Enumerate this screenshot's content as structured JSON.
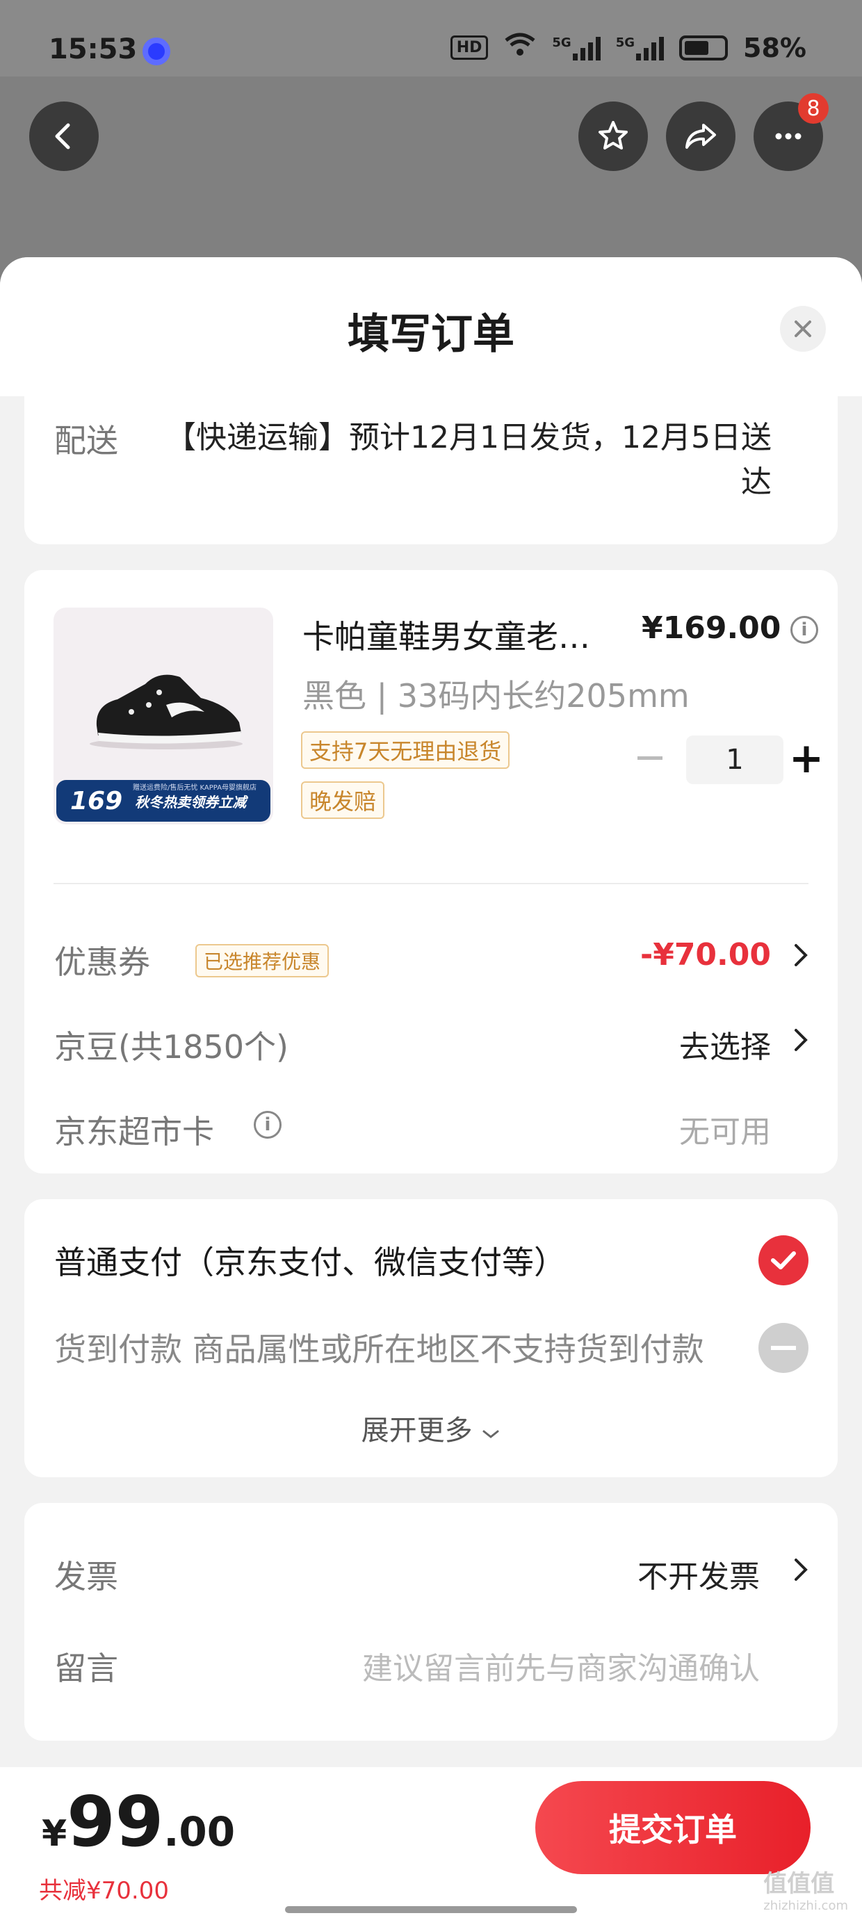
{
  "status": {
    "time": "15:53",
    "hd": "HD",
    "net1": "5G",
    "net2": "5G",
    "battery": "58%"
  },
  "nav": {
    "more_badge": "8"
  },
  "sheet": {
    "title": "填写订单"
  },
  "delivery": {
    "label": "配送",
    "text": "【快递运输】预计12月1日发货，12月5日送达"
  },
  "product": {
    "name": "卡帕童鞋男女童老…",
    "price": "¥169.00",
    "spec": "黑色 | 33码内长约205mm",
    "tags": [
      "支持7天无理由退货",
      "晚发赔"
    ],
    "quantity": "1",
    "banner_price": "169",
    "banner_text": "秋冬热卖领券立减",
    "banner_top": "赠送运费险/售后无忧  KAPPA母婴旗舰店"
  },
  "coupon": {
    "label": "优惠券",
    "tag": "已选推荐优惠",
    "value": "-¥70.00"
  },
  "jingdou": {
    "label": "京豆(共1850个)",
    "value": "去选择"
  },
  "market_card": {
    "label": "京东超市卡",
    "value": "无可用"
  },
  "payment": {
    "main": "普通支付（京东支付、微信支付等）",
    "cod": "货到付款  商品属性或所在地区不支持货到付款",
    "expand": "展开更多"
  },
  "invoice": {
    "label": "发票",
    "value": "不开发票"
  },
  "message": {
    "label": "留言",
    "placeholder": "建议留言前先与商家沟通确认"
  },
  "footer": {
    "yen": "¥",
    "total_int": "99",
    "total_dec": ".00",
    "saved": "共减¥70.00",
    "submit": "提交订单"
  },
  "watermark": {
    "text": "值值值",
    "sub": "zhizhizhi.com"
  },
  "colors": {
    "accent": "#e8313c",
    "tag": "#c8862c"
  }
}
